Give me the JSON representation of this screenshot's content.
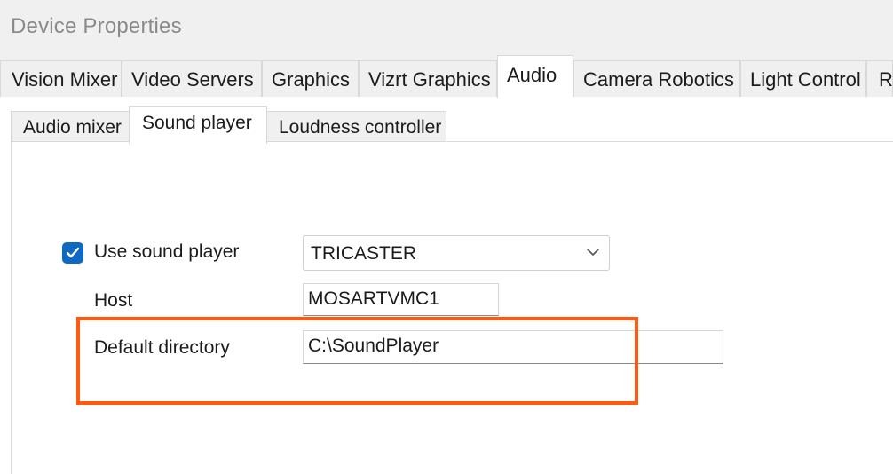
{
  "window": {
    "title": "Device Properties"
  },
  "top_tabs": [
    {
      "label": "Vision Mixer"
    },
    {
      "label": "Video Servers"
    },
    {
      "label": "Graphics"
    },
    {
      "label": "Vizrt Graphics"
    },
    {
      "label": "Audio",
      "active": true
    },
    {
      "label": "Camera Robotics"
    },
    {
      "label": "Light Control"
    },
    {
      "label": "R"
    }
  ],
  "sub_tabs": [
    {
      "label": "Audio mixer"
    },
    {
      "label": "Sound player",
      "active": true
    },
    {
      "label": "Loudness controller"
    }
  ],
  "sound_player": {
    "use_label": "Use sound player",
    "use_checked": true,
    "player_value": "TRICASTER",
    "host_label": "Host",
    "host_value": "MOSARTVMC1",
    "default_dir_label": "Default directory",
    "default_dir_value": "C:\\SoundPlayer"
  },
  "colors": {
    "accent": "#0f68c2",
    "highlight": "#ff5a0f",
    "window_bg": "#f0f0f0"
  },
  "icons": {
    "checkbox": "checkmark-icon",
    "dropdown": "chevron-down-icon"
  }
}
